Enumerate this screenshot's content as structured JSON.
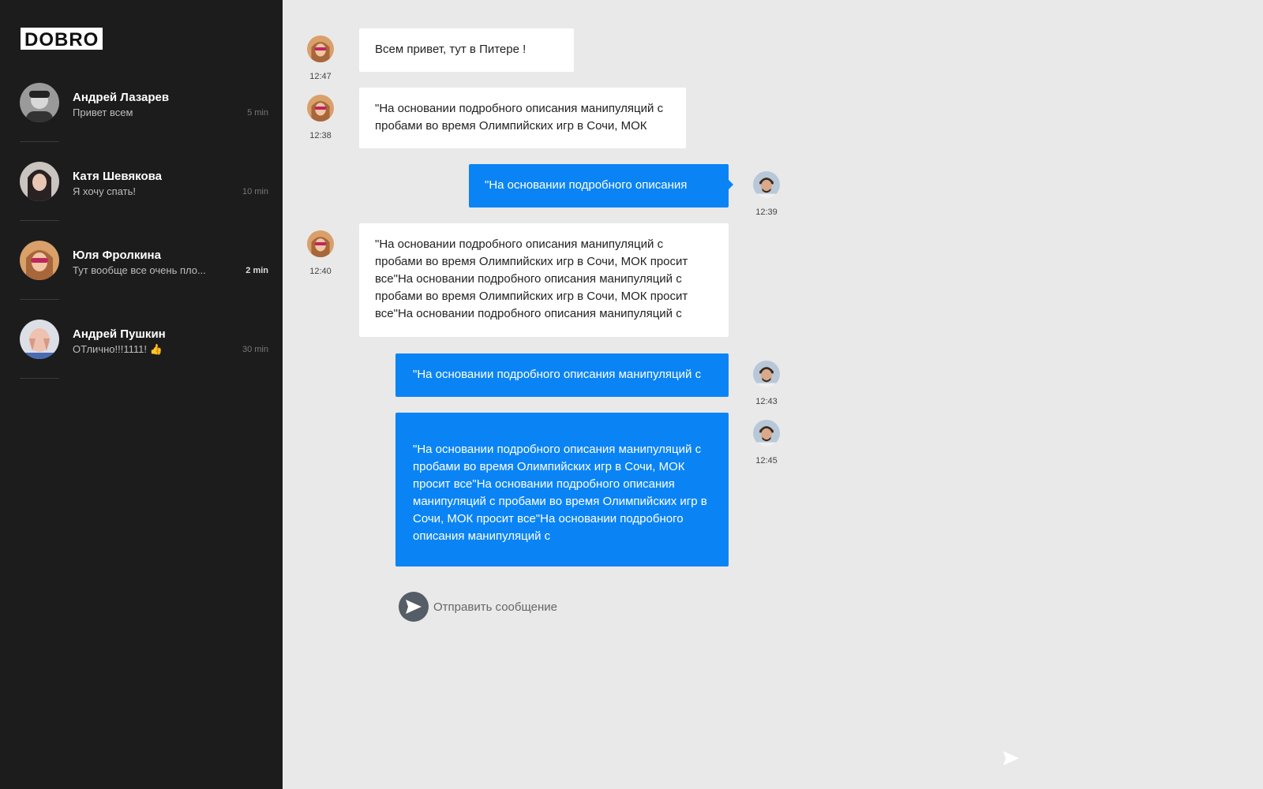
{
  "app": {
    "logo": "DOBRO"
  },
  "contacts": [
    {
      "name": "Андрей Лазарев",
      "preview": "Привет всем",
      "time": "5 min"
    },
    {
      "name": "Катя Шевякова",
      "preview": "Я хочу спать!",
      "time": "10 min"
    },
    {
      "name": "Юля Фролкина",
      "preview": "Тут вообще все очень пло...",
      "time": "2 min"
    },
    {
      "name": "Андрей Пушкин",
      "preview": "ОТлично!!!1111! 👍",
      "time": "30 min"
    }
  ],
  "messages": [
    {
      "direction": "in",
      "text": "Всем привет, тут в Питере !",
      "time": "12:47"
    },
    {
      "direction": "in",
      "text": "\"На основании подробного описания манипуляций с пробами во время Олимпийских игр в Сочи, МОК",
      "time": "12:38"
    },
    {
      "direction": "out",
      "text": "\"На основании подробного описания",
      "time": "12:39"
    },
    {
      "direction": "in",
      "text": "\"На основании подробного описания манипуляций с пробами во время Олимпийских игр в Сочи, МОК просит все\"На основании подробного описания манипуляций с пробами во время Олимпийских игр в Сочи, МОК просит все\"На основании подробного описания манипуляций с",
      "time": "12:40"
    },
    {
      "direction": "out",
      "text": "\"На основании подробного описания манипуляций с",
      "time": "12:43"
    },
    {
      "direction": "out",
      "text": "\"На основании подробного описания манипуляций с пробами во время Олимпийских игр в Сочи, МОК просит все\"На основании подробного описания манипуляций с пробами во время Олимпийских игр в Сочи, МОК просит все\"На основании подробного описания манипуляций с",
      "time": "12:45"
    }
  ],
  "composer": {
    "placeholder": "Отправить сообщение"
  },
  "icons": {
    "send": "send-icon",
    "accent": "#0a84f5",
    "sidebar_bg": "#1c1c1c",
    "chat_bg": "#e9e9e9"
  }
}
